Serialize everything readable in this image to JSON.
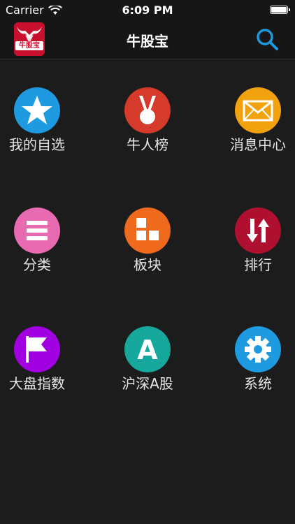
{
  "status_bar": {
    "carrier": "Carrier",
    "time": "6:09 PM"
  },
  "nav": {
    "title": "牛股宝",
    "logo_text": "牛股宝"
  },
  "colors": {
    "background": "#1c1c1c",
    "search_accent": "#1e9be0"
  },
  "menu": [
    {
      "label": "我的自选",
      "icon": "star-icon",
      "color": "#1e9be0"
    },
    {
      "label": "牛人榜",
      "icon": "medal-icon",
      "color": "#d63a2a"
    },
    {
      "label": "消息中心",
      "icon": "envelope-icon",
      "color": "#f2a20f"
    },
    {
      "label": "分类",
      "icon": "list-icon",
      "color": "#e86ab1"
    },
    {
      "label": "板块",
      "icon": "blocks-icon",
      "color": "#ef6a1c"
    },
    {
      "label": "排行",
      "icon": "sort-arrows-icon",
      "color": "#b0102f"
    },
    {
      "label": "大盘指数",
      "icon": "flag-icon",
      "color": "#a100e0"
    },
    {
      "label": "沪深A股",
      "icon": "letter-a-icon",
      "color": "#17a89d"
    },
    {
      "label": "系统",
      "icon": "gear-icon",
      "color": "#1e9be0"
    }
  ]
}
